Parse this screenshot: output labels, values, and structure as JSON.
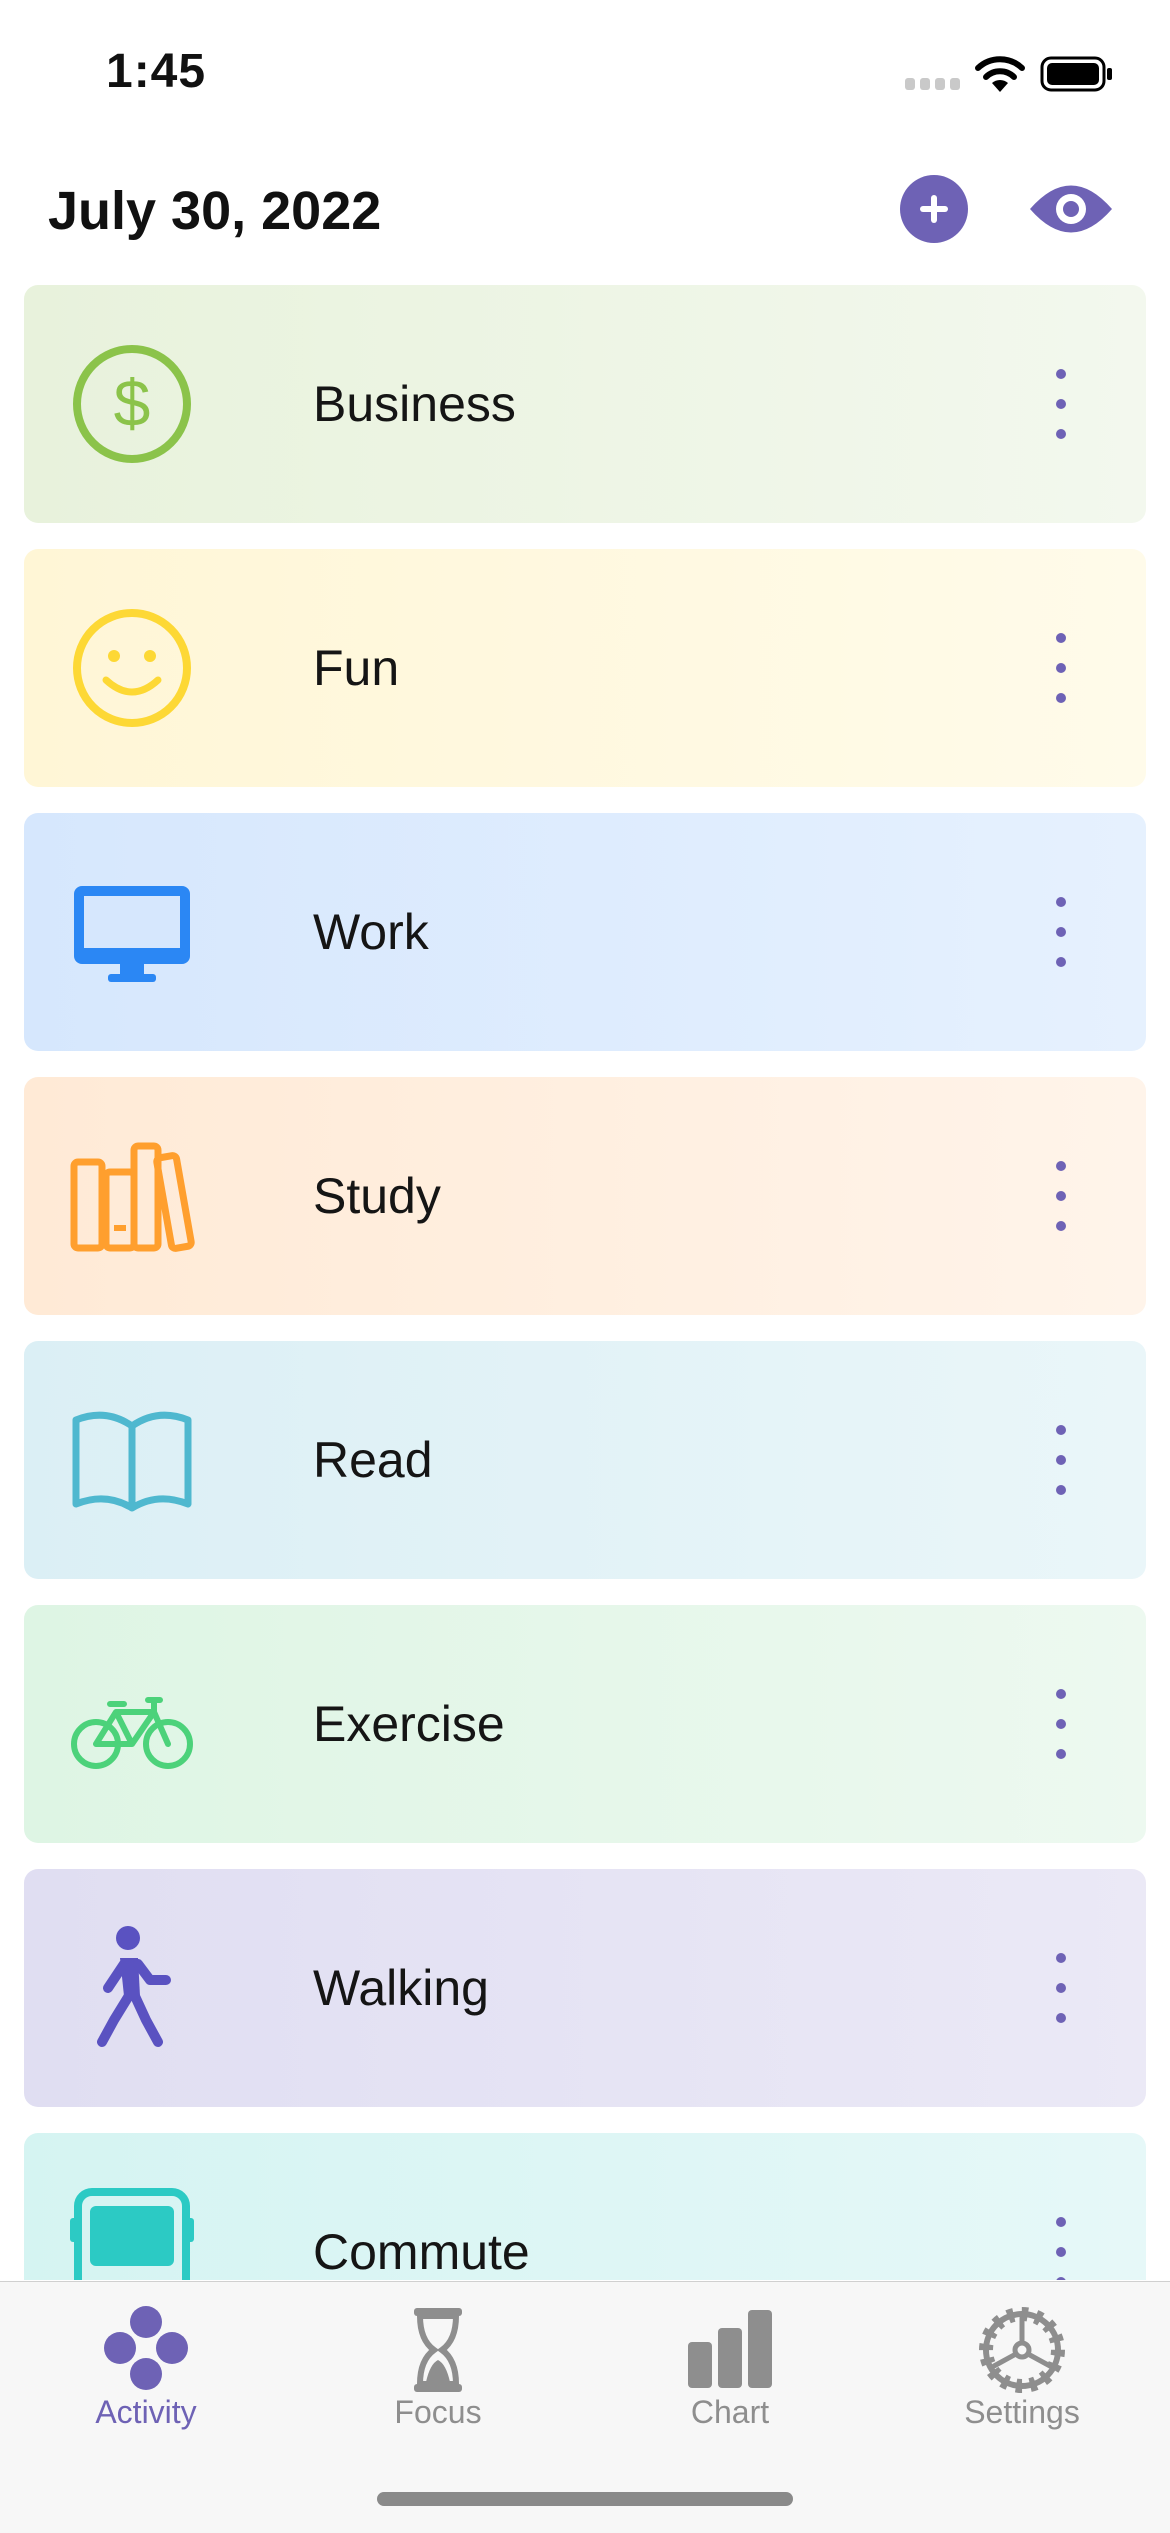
{
  "status_bar": {
    "time": "1:45"
  },
  "header": {
    "date": "July 30, 2022"
  },
  "activities": [
    {
      "label": "Business",
      "icon": "dollar-circle-icon",
      "color": "#8bc34a",
      "bg_from": "#e8f2dc",
      "bg_to": "#f3f8ee"
    },
    {
      "label": "Fun",
      "icon": "smiley-face-icon",
      "color": "#fdd835",
      "bg_from": "#fff6d6",
      "bg_to": "#fffbea"
    },
    {
      "label": "Work",
      "icon": "desktop-monitor-icon",
      "color": "#2b87f4",
      "bg_from": "#d6e7fd",
      "bg_to": "#e6f1fe"
    },
    {
      "label": "Study",
      "icon": "books-icon",
      "color": "#ff9f2e",
      "bg_from": "#ffead6",
      "bg_to": "#fff4ea"
    },
    {
      "label": "Read",
      "icon": "open-book-icon",
      "color": "#4fb8cf",
      "bg_from": "#dbeff5",
      "bg_to": "#eaf6f9"
    },
    {
      "label": "Exercise",
      "icon": "bicycle-icon",
      "color": "#4cd27a",
      "bg_from": "#def5e4",
      "bg_to": "#edf9f0"
    },
    {
      "label": "Walking",
      "icon": "walking-person-icon",
      "color": "#5a52c1",
      "bg_from": "#e0def2",
      "bg_to": "#ebe9f6"
    },
    {
      "label": "Commute",
      "icon": "bus-icon",
      "color": "#2ccac4",
      "bg_from": "#d5f4f2",
      "bg_to": "#e6f8f8"
    }
  ],
  "tabs": [
    {
      "label": "Activity",
      "icon": "activity-dots-icon",
      "active": true
    },
    {
      "label": "Focus",
      "icon": "hourglass-icon",
      "active": false
    },
    {
      "label": "Chart",
      "icon": "bar-chart-icon",
      "active": false
    },
    {
      "label": "Settings",
      "icon": "gear-icon",
      "active": false
    }
  ],
  "colors": {
    "accent": "#6e62b5",
    "inactive_tab": "#8e8e8e"
  }
}
